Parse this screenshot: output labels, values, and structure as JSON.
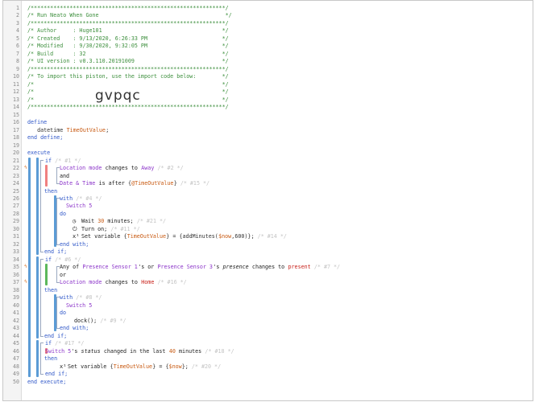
{
  "code_lines": [
    {
      "n": "1",
      "segs": [
        {
          "c": "cm",
          "t": "/************************************************************/"
        }
      ]
    },
    {
      "n": "2",
      "segs": [
        {
          "c": "cm",
          "t": "/* Run Neato When Gone                                       */"
        }
      ]
    },
    {
      "n": "3",
      "segs": [
        {
          "c": "cm",
          "t": "/************************************************************/"
        }
      ]
    },
    {
      "n": "4",
      "segs": [
        {
          "c": "cm",
          "t": "/* Author     : Huge101                                     */"
        }
      ]
    },
    {
      "n": "5",
      "segs": [
        {
          "c": "cm",
          "t": "/* Created    : 9/13/2020, 6:26:33 PM                       */"
        }
      ]
    },
    {
      "n": "6",
      "segs": [
        {
          "c": "cm",
          "t": "/* Modified   : 9/30/2020, 9:32:05 PM                       */"
        }
      ]
    },
    {
      "n": "7",
      "segs": [
        {
          "c": "cm",
          "t": "/* Build      : 32                                          */"
        }
      ]
    },
    {
      "n": "8",
      "segs": [
        {
          "c": "cm",
          "t": "/* UI version : v0.3.110.20191009                           */"
        }
      ]
    },
    {
      "n": "9",
      "segs": [
        {
          "c": "cm",
          "t": "/************************************************************/"
        }
      ]
    },
    {
      "n": "10",
      "segs": [
        {
          "c": "cm",
          "t": "/* To import this piston, use the import code below:        */"
        }
      ]
    },
    {
      "n": "11",
      "segs": [
        {
          "c": "cm",
          "t": "/*                                                          */"
        }
      ]
    },
    {
      "n": "12",
      "segs": [
        {
          "c": "cm",
          "t": "/*                                                          */"
        }
      ]
    },
    {
      "n": "13",
      "segs": [
        {
          "c": "cm",
          "t": "/*                                                          */"
        }
      ]
    },
    {
      "n": "14",
      "segs": [
        {
          "c": "cm",
          "t": "/************************************************************/"
        }
      ]
    },
    {
      "n": "15",
      "segs": []
    },
    {
      "n": "16",
      "segs": [
        {
          "c": "kw",
          "t": "define"
        }
      ]
    },
    {
      "n": "17",
      "segs": [
        {
          "c": "ty",
          "t": "   datetime "
        },
        {
          "c": "vr",
          "t": "TimeOutValue"
        },
        {
          "c": "op",
          "t": ";"
        }
      ]
    },
    {
      "n": "18",
      "segs": [
        {
          "c": "kw",
          "t": "end define;"
        }
      ]
    },
    {
      "n": "19",
      "segs": []
    },
    {
      "n": "20",
      "segs": [
        {
          "c": "kw",
          "t": "execute"
        }
      ]
    },
    {
      "n": "21",
      "segs": [
        {
          "c": "kw",
          "t": "if "
        },
        {
          "c": "cg",
          "t": "/* #1 */"
        }
      ]
    },
    {
      "n": "22",
      "segs": [
        {
          "c": "sy",
          "t": "Location mode"
        },
        {
          "c": "tx",
          "t": " changes to "
        },
        {
          "c": "dv",
          "t": "Away"
        },
        {
          "c": "cg",
          "t": " /* #2 */"
        }
      ]
    },
    {
      "n": "23",
      "segs": [
        {
          "c": "tx",
          "t": "and"
        }
      ]
    },
    {
      "n": "24",
      "segs": [
        {
          "c": "sy",
          "t": "Date & Time"
        },
        {
          "c": "tx",
          "t": " is after "
        },
        {
          "c": "ex",
          "t": "{"
        },
        {
          "c": "vr",
          "t": "@TimeOutValue"
        },
        {
          "c": "ex",
          "t": "}"
        },
        {
          "c": "cg",
          "t": " /* #15 */"
        }
      ]
    },
    {
      "n": "25",
      "segs": [
        {
          "c": "kw",
          "t": "then"
        }
      ]
    },
    {
      "n": "26",
      "segs": [
        {
          "c": "kw",
          "t": "with "
        },
        {
          "c": "cg",
          "t": "/* #4 */"
        }
      ]
    },
    {
      "n": "27",
      "segs": [
        {
          "c": "dv",
          "t": "  Switch 5"
        }
      ]
    },
    {
      "n": "28",
      "segs": [
        {
          "c": "kw",
          "t": "do"
        }
      ]
    },
    {
      "n": "29",
      "segs": [
        {
          "c": "tx",
          "t": "Wait "
        },
        {
          "c": "nm",
          "t": "30"
        },
        {
          "c": "tx",
          "t": " minutes;"
        },
        {
          "c": "cg",
          "t": " /* #21 */"
        }
      ]
    },
    {
      "n": "30",
      "segs": [
        {
          "c": "tx",
          "t": "Turn on;"
        },
        {
          "c": "cg",
          "t": " /* #11 */"
        }
      ]
    },
    {
      "n": "31",
      "segs": [
        {
          "c": "tx",
          "t": "Set variable "
        },
        {
          "c": "ex",
          "t": "{"
        },
        {
          "c": "vr",
          "t": "TimeOutValue"
        },
        {
          "c": "ex",
          "t": "}"
        },
        {
          "c": "tx",
          "t": " = "
        },
        {
          "c": "ex",
          "t": "{addMinutes("
        },
        {
          "c": "sv",
          "t": "$now"
        },
        {
          "c": "ex",
          "t": ",600)}"
        },
        {
          "c": "tx",
          "t": ";"
        },
        {
          "c": "cg",
          "t": " /* #14 */"
        }
      ]
    },
    {
      "n": "32",
      "segs": [
        {
          "c": "kw",
          "t": "end with;"
        }
      ]
    },
    {
      "n": "33",
      "segs": [
        {
          "c": "kw",
          "t": "end if;"
        }
      ]
    },
    {
      "n": "34",
      "segs": [
        {
          "c": "kw",
          "t": "if "
        },
        {
          "c": "cg",
          "t": "/* #6 */"
        }
      ]
    },
    {
      "n": "35",
      "segs": [
        {
          "c": "tx",
          "t": "Any of "
        },
        {
          "c": "dv",
          "t": "Presence Sensor 1"
        },
        {
          "c": "tx",
          "t": "'s or "
        },
        {
          "c": "dv",
          "t": "Presence Sensor 3"
        },
        {
          "c": "tx",
          "t": "'s "
        },
        {
          "c": "em",
          "t": "presence"
        },
        {
          "c": "tx",
          "t": " changes to "
        },
        {
          "c": "st",
          "t": "present"
        },
        {
          "c": "cg",
          "t": " /* #7 */"
        }
      ]
    },
    {
      "n": "36",
      "segs": [
        {
          "c": "tx",
          "t": "or"
        }
      ]
    },
    {
      "n": "37",
      "segs": [
        {
          "c": "sy",
          "t": "Location mode"
        },
        {
          "c": "tx",
          "t": " changes to "
        },
        {
          "c": "st",
          "t": "Home"
        },
        {
          "c": "cg",
          "t": " /* #16 */"
        }
      ]
    },
    {
      "n": "38",
      "segs": [
        {
          "c": "kw",
          "t": "then"
        }
      ]
    },
    {
      "n": "39",
      "segs": [
        {
          "c": "kw",
          "t": "with "
        },
        {
          "c": "cg",
          "t": "/* #8 */"
        }
      ]
    },
    {
      "n": "40",
      "segs": [
        {
          "c": "dv",
          "t": "  Switch 5"
        }
      ]
    },
    {
      "n": "41",
      "segs": [
        {
          "c": "kw",
          "t": "do"
        }
      ]
    },
    {
      "n": "42",
      "segs": [
        {
          "c": "tx",
          "t": "dock();"
        },
        {
          "c": "cg",
          "t": " /* #9 */"
        }
      ]
    },
    {
      "n": "43",
      "segs": [
        {
          "c": "kw",
          "t": "end with;"
        }
      ]
    },
    {
      "n": "44",
      "segs": [
        {
          "c": "kw",
          "t": "end if;"
        }
      ]
    },
    {
      "n": "45",
      "segs": [
        {
          "c": "kw",
          "t": "if "
        },
        {
          "c": "cg",
          "t": "/* #17 */"
        }
      ]
    },
    {
      "n": "46",
      "segs": [
        {
          "c": "dv",
          "t": "Switch 5"
        },
        {
          "c": "tx",
          "t": "'s "
        },
        {
          "c": "em",
          "t": "status"
        },
        {
          "c": "tx",
          "t": " changed in the last "
        },
        {
          "c": "nm",
          "t": "40"
        },
        {
          "c": "tx",
          "t": " minutes"
        },
        {
          "c": "cg",
          "t": " /* #18 */"
        }
      ]
    },
    {
      "n": "47",
      "segs": [
        {
          "c": "kw",
          "t": "then"
        }
      ]
    },
    {
      "n": "48",
      "segs": [
        {
          "c": "tx",
          "t": "Set variable "
        },
        {
          "c": "ex",
          "t": "{"
        },
        {
          "c": "vr",
          "t": "TimeOutValue"
        },
        {
          "c": "ex",
          "t": "}"
        },
        {
          "c": "tx",
          "t": " = "
        },
        {
          "c": "ex",
          "t": "{"
        },
        {
          "c": "sv",
          "t": "$now"
        },
        {
          "c": "ex",
          "t": "}"
        },
        {
          "c": "tx",
          "t": ";"
        },
        {
          "c": "cg",
          "t": " /* #20 */"
        }
      ]
    },
    {
      "n": "49",
      "segs": [
        {
          "c": "kw",
          "t": "end if;"
        }
      ]
    },
    {
      "n": "50",
      "segs": [
        {
          "c": "kw",
          "t": "end execute;"
        }
      ]
    }
  ],
  "captcha_text": "gvpqc",
  "icons": {
    "wait": "clock-icon",
    "turn_on": "power-icon",
    "set_variable": "variable-icon",
    "trigger": "lightning-icon"
  },
  "colors": {
    "comment": "#3d8f3d",
    "keyword": "#2e56c8",
    "device": "#8b34c9",
    "variable": "#c85a12",
    "state": "#c8211a",
    "bar_blue": "#5b9bd5",
    "bar_red": "#f08080",
    "bar_green": "#5cb85c",
    "trigger": "#d46a1a"
  }
}
